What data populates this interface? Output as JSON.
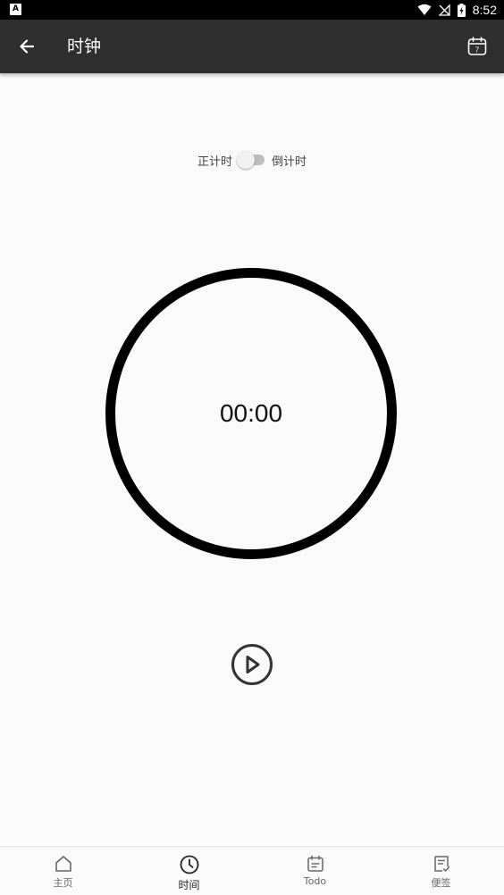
{
  "status_bar": {
    "time": "8:52",
    "left_icon": "a-notification-icon"
  },
  "app_bar": {
    "title": "时钟",
    "back_icon": "arrow-left-icon",
    "calendar_icon": "calendar-icon",
    "calendar_day": "7"
  },
  "timer_mode": {
    "left_label": "正计时",
    "right_label": "倒计时",
    "switch_on": false
  },
  "timer": {
    "display": "00:00"
  },
  "controls": {
    "play_icon": "play-icon"
  },
  "bottom_nav": {
    "items": [
      {
        "label": "主页",
        "icon": "home-icon",
        "active": false
      },
      {
        "label": "时间",
        "icon": "clock-icon",
        "active": true
      },
      {
        "label": "Todo",
        "icon": "todo-icon",
        "active": false
      },
      {
        "label": "便签",
        "icon": "note-icon",
        "active": false
      }
    ]
  },
  "colors": {
    "app_bar": "#2e2e2e",
    "background": "#fafafa",
    "ring": "#000000"
  }
}
